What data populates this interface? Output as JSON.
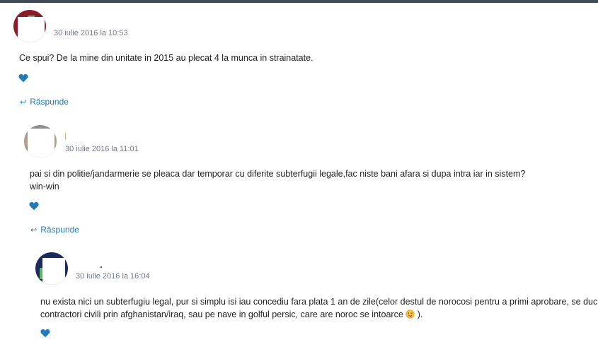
{
  "colors": {
    "topbar": "#3d4a55",
    "link": "#1f7ab8",
    "heart": "#1f7ab8",
    "meta": "#6b7a85"
  },
  "comments": [
    {
      "date": "30 iulie 2016 la 10:53",
      "lines": [
        "Ce spui? De la mine din unitate in 2015 au plecat 4 la munca in strainatate."
      ],
      "reply_label": "Răspunde"
    },
    {
      "date": "30 iulie 2016 la 11:01",
      "lines": [
        "pai si din politie/jandarmerie se pleaca dar temporar cu diferite subterfugii legale,fac niste bani afara si dupa intra iar in sistem?",
        "win-win"
      ],
      "reply_label": "Răspunde"
    },
    {
      "date": "30 iulie 2016 la 16:04",
      "lines": [
        "nu exista nici un subterfugiu legal, pur si simplu isi iau concediu fara plata 1 an de zile(celor destul de norocosi pentru a primi aprobare, se duc",
        "contractori civili prin afghanistan/iraq, sau pe nave in golful persic, care are noroc se intoarce",
        ")."
      ]
    }
  ],
  "icons": {
    "heart": "heart-icon",
    "reply_arrow": "reply-arrow-icon",
    "emoji": "wink-tongue-emoji-icon"
  }
}
